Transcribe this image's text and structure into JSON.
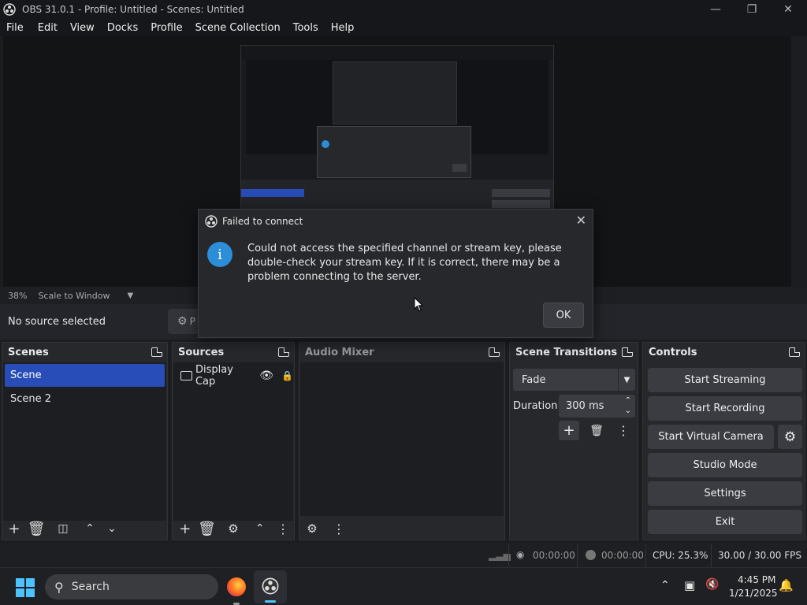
{
  "window": {
    "title": "OBS 31.0.1 - Profile: Untitled - Scenes: Untitled"
  },
  "menu": [
    "File",
    "Edit",
    "View",
    "Docks",
    "Profile",
    "Scene Collection",
    "Tools",
    "Help"
  ],
  "preview": {
    "zoom": "38%",
    "scale_mode": "Scale to Window"
  },
  "source_toolbar": {
    "status": "No source selected",
    "properties_label": "P"
  },
  "scenes": {
    "title": "Scenes",
    "items": [
      "Scene",
      "Scene 2"
    ],
    "selected": 0
  },
  "sources": {
    "title": "Sources",
    "items": [
      "Display Cap"
    ]
  },
  "audio_mixer": {
    "title": "Audio Mixer"
  },
  "transitions": {
    "title": "Scene Transitions",
    "type": "Fade",
    "duration_label": "Duration",
    "duration": "300 ms"
  },
  "controls": {
    "title": "Controls",
    "buttons": [
      "Start Streaming",
      "Start Recording",
      "Start Virtual Camera",
      "Studio Mode",
      "Settings",
      "Exit"
    ]
  },
  "status": {
    "stream_time": "00:00:00",
    "rec_time": "00:00:00",
    "cpu": "CPU: 25.3%",
    "fps": "30.00 / 30.00 FPS"
  },
  "dialog": {
    "title": "Failed to connect",
    "message": "Could not access the specified channel or stream key, please double-check your stream key. If it is correct, there may be a problem connecting to the server.",
    "ok": "OK"
  },
  "taskbar": {
    "search": "Search",
    "time": "4:45 PM",
    "date": "1/21/2025"
  },
  "colors": {
    "accent": "#284cb8",
    "info": "#2c8dd8"
  }
}
